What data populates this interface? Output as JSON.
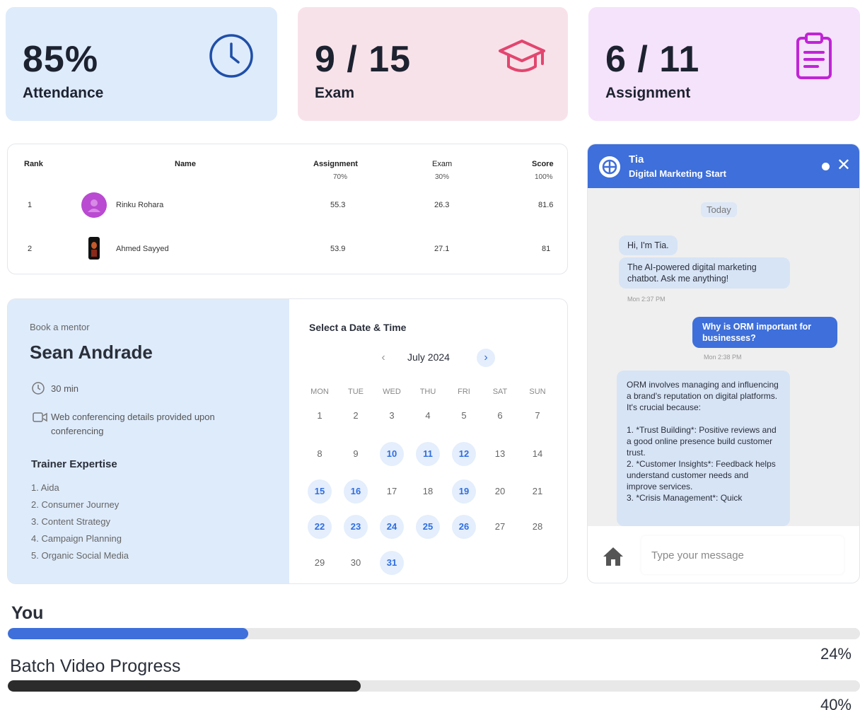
{
  "stats": [
    {
      "value": "85%",
      "label": "Attendance",
      "icon": "clock-icon",
      "color": "#1f4fa8"
    },
    {
      "value": "9 / 15",
      "label": "Exam",
      "icon": "graduation-cap-icon",
      "color": "#e2466f"
    },
    {
      "value": "6 / 11",
      "label": "Assignment",
      "icon": "clipboard-icon",
      "color": "#c024d6"
    }
  ],
  "leaderboard": {
    "headers": {
      "rank": "Rank",
      "name": "Name",
      "assignment": "Assignment",
      "assignment_weight": "70%",
      "exam": "Exam",
      "exam_weight": "30%",
      "score": "Score",
      "score_weight": "100%"
    },
    "rows": [
      {
        "rank": "1",
        "name": "Rinku Rohara",
        "assignment": "55.3",
        "exam": "26.3",
        "score": "81.6"
      },
      {
        "rank": "2",
        "name": "Ahmed Sayyed",
        "assignment": "53.9",
        "exam": "27.1",
        "score": "81"
      }
    ]
  },
  "mentor": {
    "eyebrow": "Book a mentor",
    "name": "Sean Andrade",
    "duration": "30 min",
    "conferencing": "Web conferencing details provided upon conferencing",
    "expertise_title": "Trainer Expertise",
    "expertise": [
      "1. Aida",
      "2. Consumer Journey",
      "3. Content Strategy",
      "4. Campaign Planning",
      "5. Organic Social Media"
    ]
  },
  "calendar": {
    "title": "Select a Date & Time",
    "month": "July 2024",
    "prev": "‹",
    "next": "›",
    "weekdays": [
      "MON",
      "TUE",
      "WED",
      "THU",
      "FRI",
      "SAT",
      "SUN"
    ],
    "days": [
      "1",
      "2",
      "3",
      "4",
      "5",
      "6",
      "7",
      "8",
      "9",
      "10",
      "11",
      "12",
      "13",
      "14",
      "15",
      "16",
      "17",
      "18",
      "19",
      "20",
      "21",
      "22",
      "23",
      "24",
      "25",
      "26",
      "27",
      "28",
      "29",
      "30",
      "31"
    ],
    "available": [
      10,
      11,
      12,
      15,
      16,
      19,
      22,
      23,
      24,
      25,
      26,
      31
    ]
  },
  "chat": {
    "bot_name": "Tia",
    "bot_subtitle": "Digital Marketing Start",
    "close": "✕",
    "date_divider": "Today",
    "messages": [
      {
        "from": "bot",
        "text": "Hi, I'm Tia."
      },
      {
        "from": "bot",
        "text": "The AI-powered digital marketing chatbot. Ask me anything!",
        "time": "Mon 2:37 PM"
      },
      {
        "from": "user",
        "text": "Why is ORM important for businesses?",
        "time": "Mon 2:38 PM"
      },
      {
        "from": "bot",
        "text": "ORM involves managing and influencing a brand's reputation on digital platforms. It's crucial because:\n\n1. *Trust Building*: Positive reviews and a good online presence build customer trust.\n2. *Customer Insights*: Feedback helps understand customer needs and improve services.\n3. *Crisis Management*: Quick"
      }
    ],
    "input_placeholder": "Type your message"
  },
  "progress": [
    {
      "label": "You",
      "percent": 24,
      "percent_text": "24%",
      "color": "#3e6fda"
    },
    {
      "label": "Batch Video Progress",
      "percent": 40,
      "percent_text": "40%",
      "color": "#2b2b2b"
    }
  ]
}
